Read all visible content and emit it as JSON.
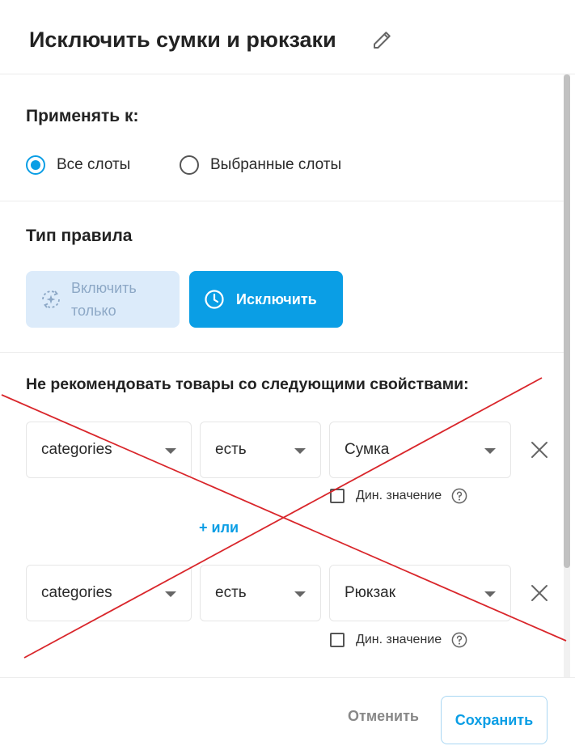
{
  "header": {
    "title": "Исключить сумки и рюкзаки",
    "edit_icon": "pencil-icon"
  },
  "apply_to": {
    "heading": "Применять к:",
    "options": [
      {
        "label": "Все слоты",
        "selected": true
      },
      {
        "label": "Выбранные слоты",
        "selected": false
      }
    ]
  },
  "rule_type": {
    "heading": "Тип правила",
    "include_label": "Включить только",
    "include_icon": "sparkle-refresh-icon",
    "exclude_label": "Исключить",
    "exclude_icon": "clock-icon",
    "active": "exclude"
  },
  "conditions": {
    "heading": "Не рекомендовать товары со следующими свойствами:",
    "rows": [
      {
        "property": "categories",
        "operator": "есть",
        "value": "Сумка",
        "dynamic_label": "Дин. значение",
        "dynamic_checked": false
      },
      {
        "property": "categories",
        "operator": "есть",
        "value": "Рюкзак",
        "dynamic_label": "Дин. значение",
        "dynamic_checked": false
      }
    ],
    "or_link": "+ или"
  },
  "footer": {
    "cancel_label": "Отменить",
    "save_label": "Сохранить"
  },
  "colors": {
    "accent": "#0a9ee5",
    "include_bg": "#dcebfa",
    "strike": "#d9262b"
  }
}
